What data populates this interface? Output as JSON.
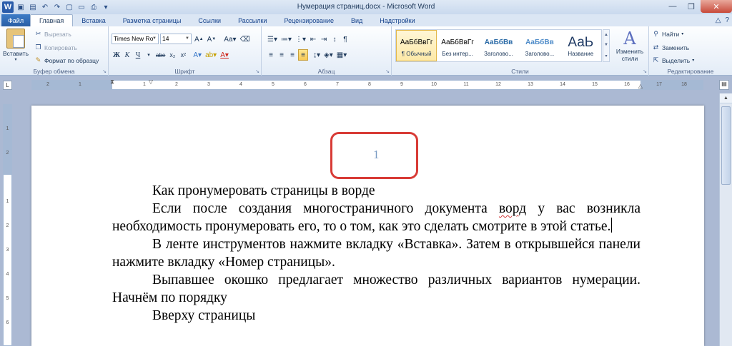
{
  "window": {
    "title": "Нумерация страниц.docx - Microsoft Word"
  },
  "tabs": {
    "file": "Файл",
    "items": [
      "Главная",
      "Вставка",
      "Разметка страницы",
      "Ссылки",
      "Рассылки",
      "Рецензирование",
      "Вид",
      "Надстройки"
    ],
    "active": "Главная"
  },
  "clipboard": {
    "paste": "Вставить",
    "cut": "Вырезать",
    "copy": "Копировать",
    "format_painter": "Формат по образцу",
    "label": "Буфер обмена"
  },
  "font": {
    "name": "Times New Ro",
    "size": "14",
    "label": "Шрифт"
  },
  "paragraph": {
    "label": "Абзац"
  },
  "styles": {
    "items": [
      {
        "sample": "АаБбВвГг",
        "name": "¶ Обычный"
      },
      {
        "sample": "АаБбВвГг",
        "name": "Без интер..."
      },
      {
        "sample": "АаБбВв",
        "name": "Заголово..."
      },
      {
        "sample": "АаБбВв",
        "name": "Заголово..."
      },
      {
        "sample": "АаЬ",
        "name": "Название"
      }
    ],
    "change_styles": [
      "Изменить",
      "стили"
    ],
    "label": "Стили"
  },
  "editing": {
    "find": "Найти",
    "replace": "Заменить",
    "select": "Выделить",
    "label": "Редактирование"
  },
  "ruler": {
    "numbers": [
      "2",
      "1",
      "1",
      "2",
      "3",
      "4",
      "5",
      "6",
      "7",
      "8",
      "9",
      "10",
      "11",
      "12",
      "13",
      "14",
      "15",
      "16",
      "17",
      "18"
    ],
    "vnumbers": [
      "1",
      "2",
      "3",
      "4",
      "5",
      "6",
      "7"
    ]
  },
  "document": {
    "page_number": "1",
    "heading": "Как пронумеровать страницы в ворде",
    "p1_a": "Если после создания многостраничного документа ",
    "p1_word": "ворд",
    "p1_b": " у вас возникла необходимость пронумеровать его, то о том, как это сделать смотрите в этой статье.",
    "p2": "В ленте инструментов нажмите вкладку «Вставка». Затем в открывшейся панели нажмите вкладку «Номер страницы».",
    "p3": "Выпавшее окошко предлагает множество различных вариантов нумерации. Начнём по порядку",
    "p4": "Вверху страницы"
  }
}
